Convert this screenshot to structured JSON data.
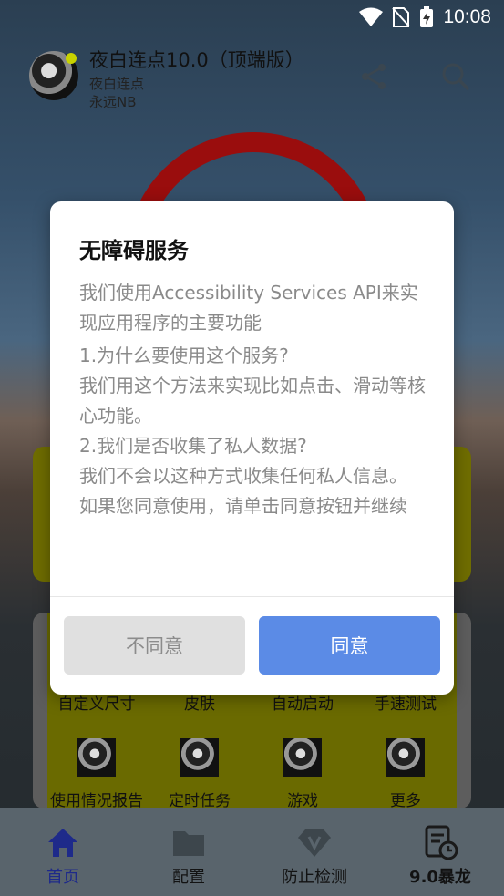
{
  "status_bar": {
    "time": "10:08"
  },
  "app": {
    "title": "夜白连点10.0（顶端版）",
    "subtitle1": "夜白连点",
    "subtitle2": "永远NB"
  },
  "grid": {
    "row1": [
      "自定义尺寸",
      "皮肤",
      "自动启动",
      "手速测试"
    ],
    "row2": [
      "使用情况报告",
      "定时任务",
      "游戏",
      "更多"
    ]
  },
  "bottom_nav": {
    "items": [
      {
        "label": "首页",
        "icon": "home-icon"
      },
      {
        "label": "配置",
        "icon": "folder-icon"
      },
      {
        "label": "防止检测",
        "icon": "diamond-v-icon"
      },
      {
        "label": "9.0暴龙",
        "icon": "document-clock-icon"
      }
    ]
  },
  "dialog": {
    "title": "无障碍服务",
    "intro": "我们使用Accessibility Services API来实现应用程序的主要功能",
    "body": "1.为什么要使用这个服务?\n我们用这个方法来实现比如点击、滑动等核心功能。\n2.我们是否收集了私人数据?\n我们不会以这种方式收集任何私人信息。\n如果您同意使用，请单击同意按钮并继续",
    "decline_label": "不同意",
    "accept_label": "同意"
  },
  "colors": {
    "accept": "#5b8be6",
    "decline": "#e0e0e0",
    "nav_active": "#1e2a8a",
    "ring": "#9a0d0d"
  }
}
